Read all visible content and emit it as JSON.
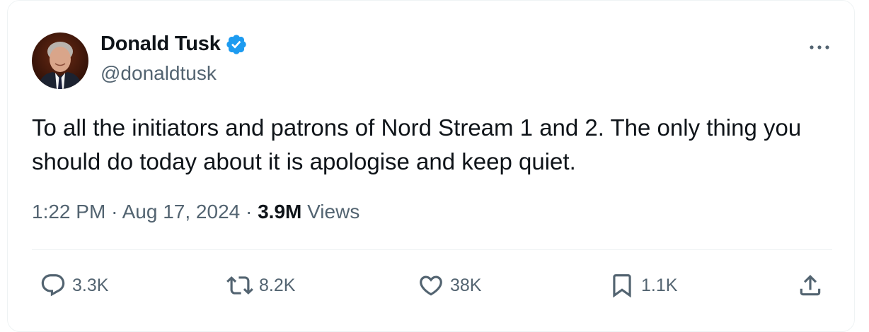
{
  "author": {
    "name": "Donald Tusk",
    "handle": "@donaldtusk",
    "verified": true
  },
  "tweet": {
    "text": "To all the initiators and patrons of Nord Stream 1 and 2. The only thing you should do today about it is apologise and keep quiet.",
    "time": "1:22 PM",
    "separator": "·",
    "date": "Aug 17, 2024",
    "views_count": "3.9M",
    "views_label": "Views"
  },
  "actions": {
    "replies": "3.3K",
    "reposts": "8.2K",
    "likes": "38K",
    "bookmarks": "1.1K"
  },
  "icons": {
    "verified": "verified-badge-icon",
    "more": "more-options-icon",
    "reply": "reply-icon",
    "repost": "repost-icon",
    "like": "heart-icon",
    "bookmark": "bookmark-icon",
    "share": "share-icon"
  },
  "colors": {
    "verified_blue": "#1d9bf0",
    "text_primary": "#0f1419",
    "text_secondary": "#536471",
    "divider": "#eff3f4"
  }
}
